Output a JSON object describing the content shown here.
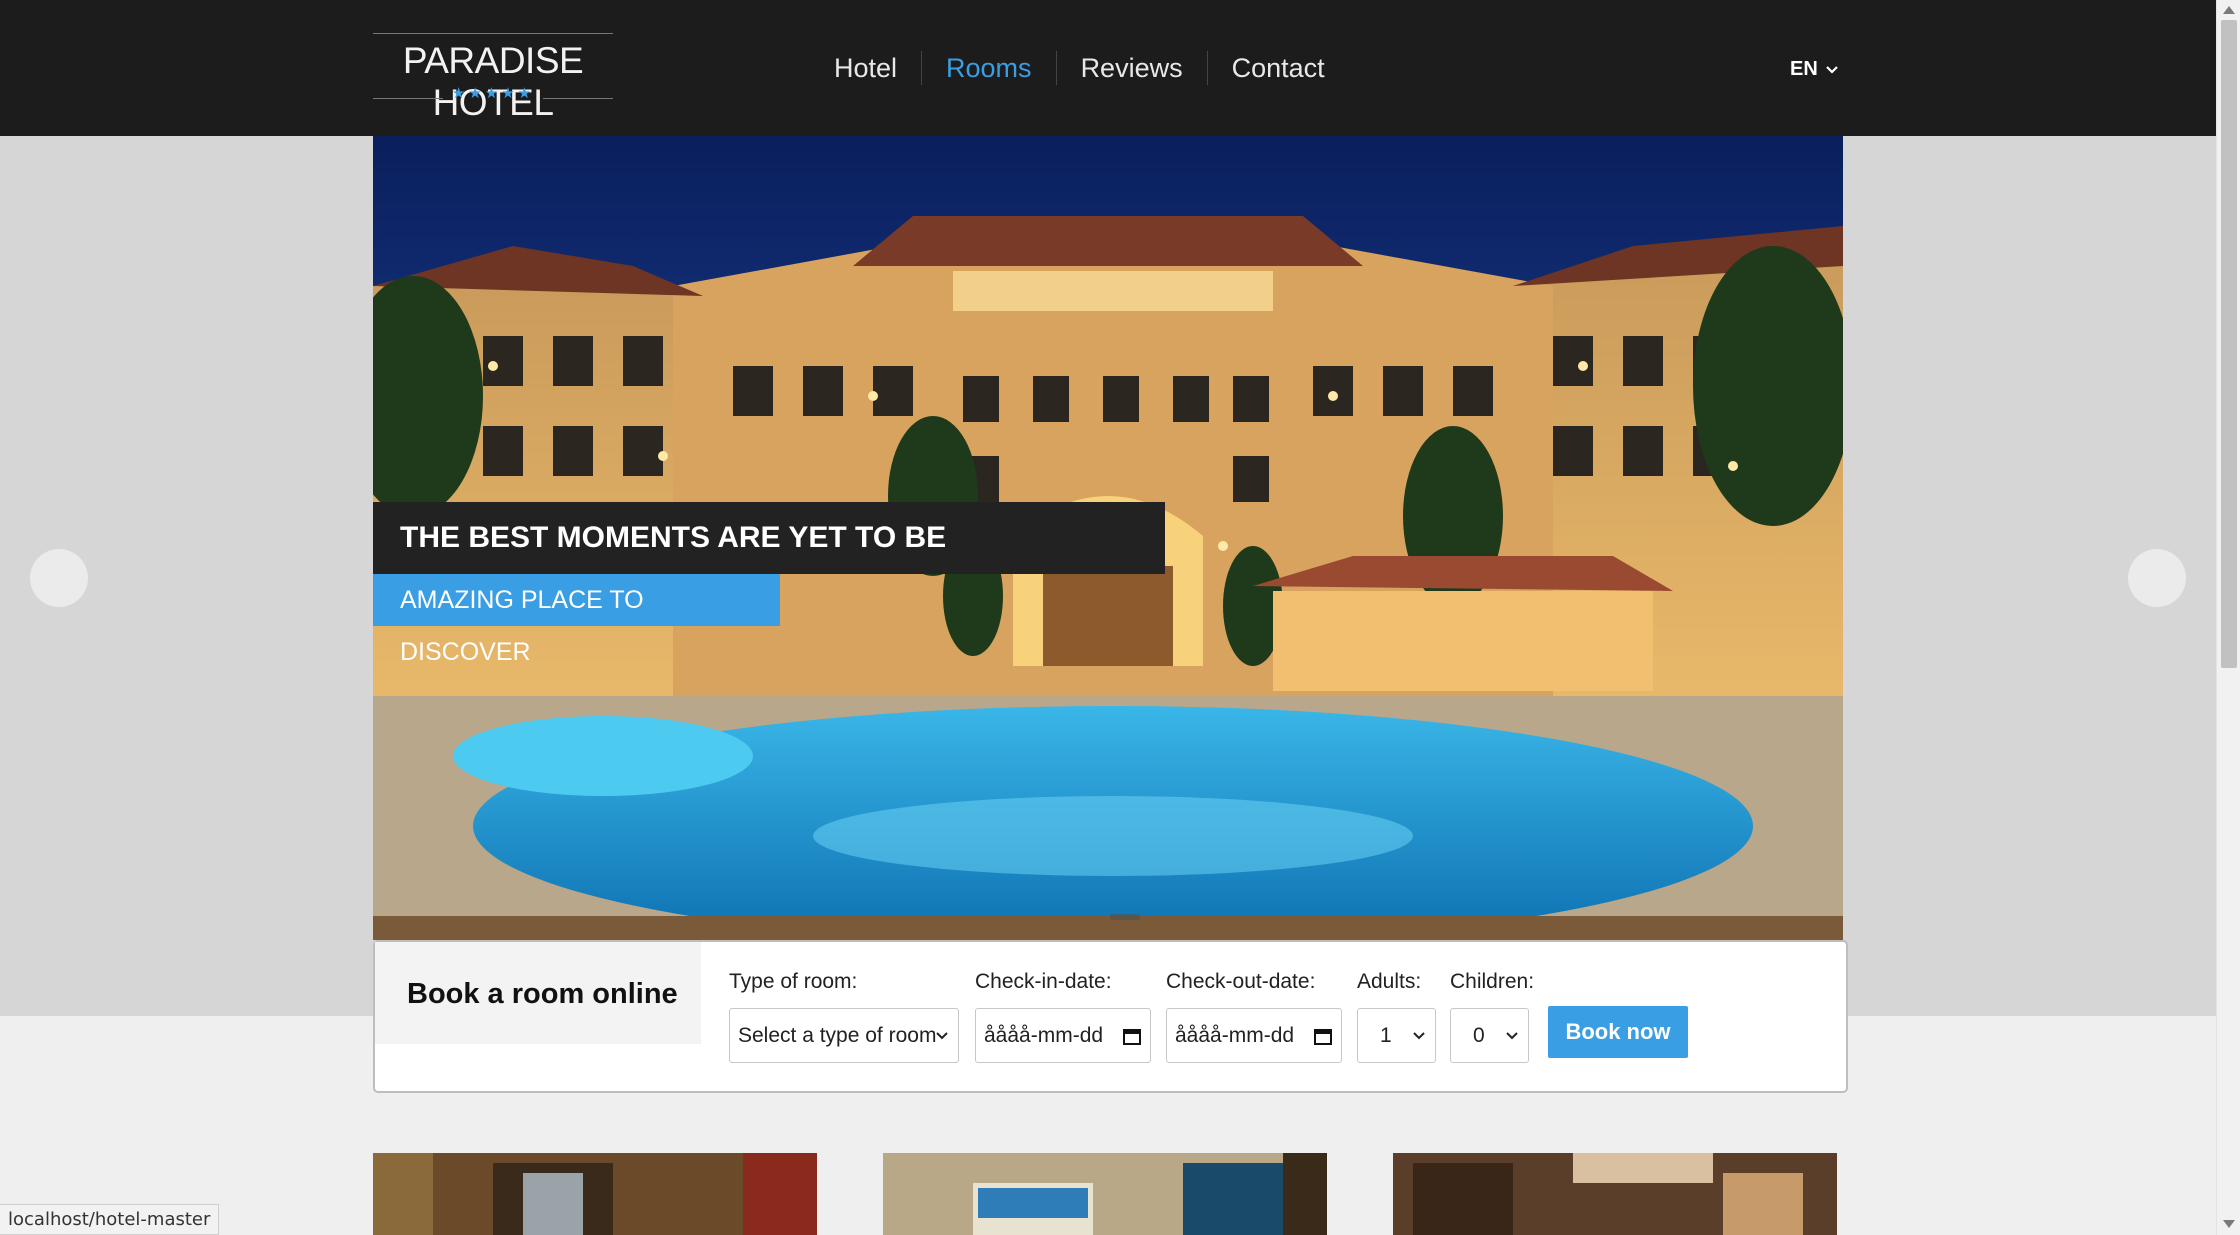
{
  "header": {
    "logo_text": "PARADISE HOTEL",
    "logo_stars": "★★★★★",
    "nav": [
      {
        "label": "Hotel"
      },
      {
        "label": "Rooms"
      },
      {
        "label": "Reviews"
      },
      {
        "label": "Contact"
      }
    ],
    "active_nav": "Rooms",
    "language": "EN"
  },
  "hero": {
    "headline": "THE BEST MOMENTS ARE YET TO BE EXPERIENCED",
    "subheadline": "AMAZING PLACE TO DISCOVER"
  },
  "booking": {
    "title": "Book a room online",
    "room_type_label": "Type of room:",
    "room_type_value": "Select a type of room",
    "checkin_label": "Check-in-date:",
    "checkin_value": "åååå-mm-dd",
    "checkout_label": "Check-out-date:",
    "checkout_value": "åååå-mm-dd",
    "adults_label": "Adults:",
    "adults_value": "1",
    "children_label": "Children:",
    "children_value": "0",
    "button_label": "Book now"
  },
  "status_bar": {
    "url": "localhost/hotel-master"
  },
  "colors": {
    "accent": "#3a9ee4",
    "header_bg": "#1c1c1c",
    "caption_bg": "#222222"
  }
}
